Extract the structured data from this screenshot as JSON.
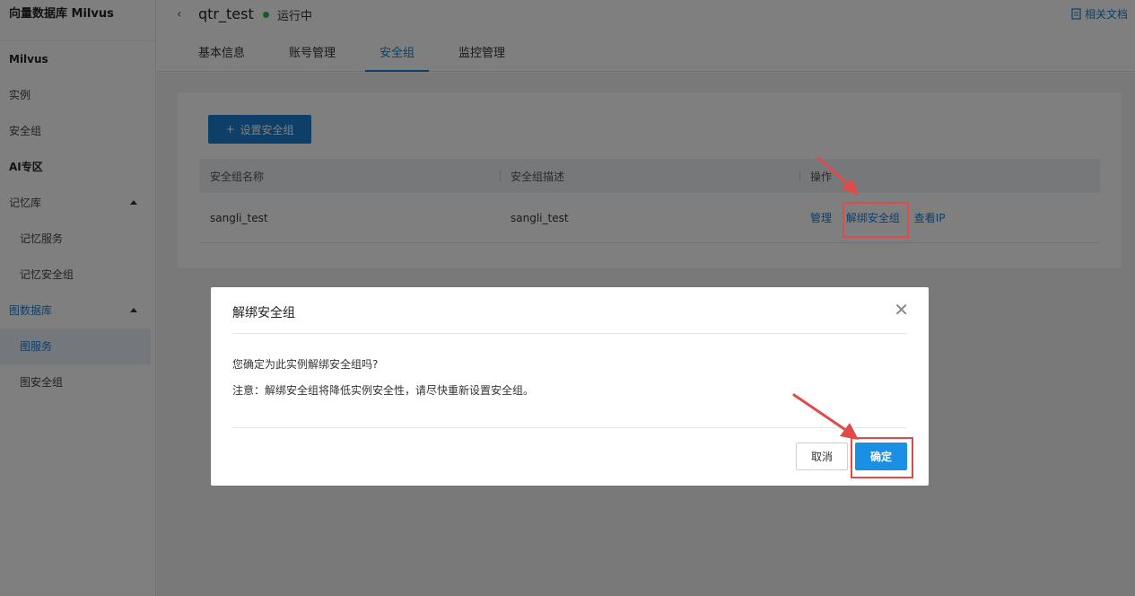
{
  "sidebar": {
    "title": "向量数据库 Milvus",
    "sections": [
      {
        "label": "Milvus"
      },
      {
        "label": "AI专区"
      }
    ],
    "items": {
      "instance": "实例",
      "security_group": "安全组",
      "memory_lib": "记忆库",
      "memory_service": "记忆服务",
      "memory_security": "记忆安全组",
      "graph_db": "图数据库",
      "graph_service": "图服务",
      "graph_security": "图安全组"
    }
  },
  "header": {
    "instance_name": "qtr_test",
    "status": "运行中",
    "doc_link": "相关文档",
    "tabs": [
      "基本信息",
      "账号管理",
      "安全组",
      "监控管理"
    ],
    "active_tab": 2
  },
  "panel": {
    "add_button": "设置安全组",
    "columns": [
      "安全组名称",
      "安全组描述",
      "操作"
    ],
    "rows": [
      {
        "name": "sangli_test",
        "desc": "sangli_test",
        "actions": [
          "管理",
          "解绑安全组",
          "查看IP"
        ]
      }
    ]
  },
  "dialog": {
    "title": "解绑安全组",
    "message": "您确定为此实例解绑安全组吗?",
    "note": "注意：解绑安全组将降低实例安全性，请尽快重新设置安全组。",
    "cancel": "取消",
    "ok": "确定"
  },
  "colors": {
    "accent": "#1a7fd3",
    "ok_button": "#1a8fe3",
    "status": "#2fb84a",
    "highlight": "#e04a4a"
  }
}
